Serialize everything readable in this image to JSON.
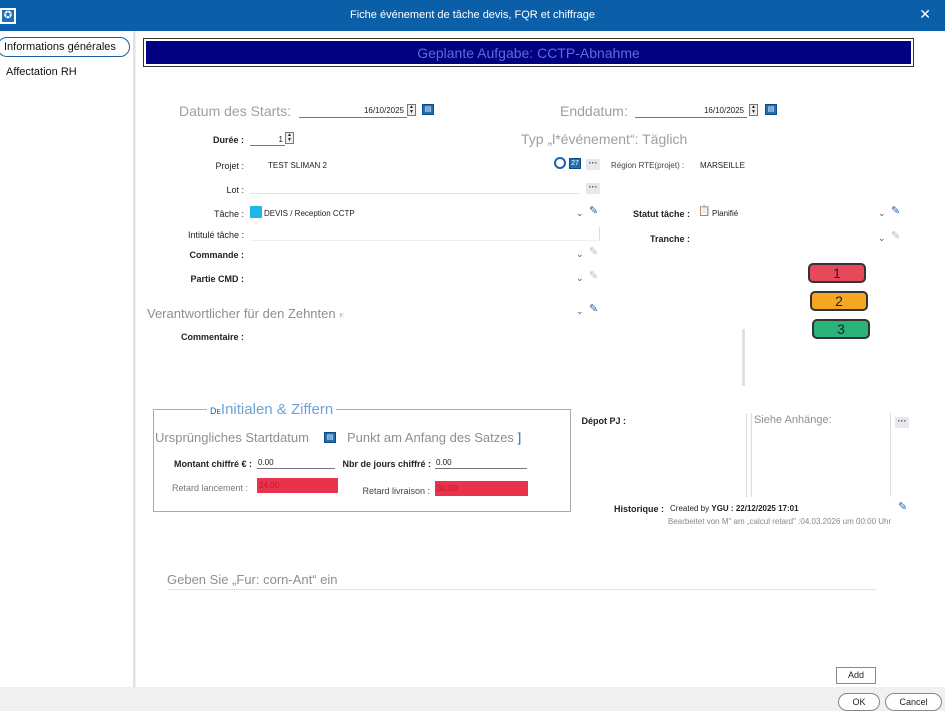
{
  "window": {
    "title": "Fiche événement de tâche devis, FQR et chiffrage",
    "close": "✕",
    "app_icon": "✪"
  },
  "sidebar": {
    "items": [
      {
        "label": "Informations générales"
      },
      {
        "label": "Affectation RH"
      }
    ]
  },
  "header": {
    "title": "Geplante Aufgabe: CCTP-Abnahme"
  },
  "form": {
    "start_label": "Datum des Starts:",
    "start_value": "16/10/2025",
    "end_label": "Enddatum:",
    "end_value": "16/10/2025",
    "duree_label": "Durée :",
    "duree_value": "1",
    "type_label": "Typ „l*événement“: Täglich",
    "projet_label": "Projet :",
    "projet_value": "TEST SLIMAN 2",
    "projet_icon_text": "27",
    "region_label": "Région RTE(projet) :",
    "region_value": "MARSEILLE",
    "lot_label": "Lot :",
    "tache_label": "Tâche :",
    "tache_value": "DEVIS / Reception CCTP",
    "statut_label": "Statut tâche :",
    "statut_value": "Planifié",
    "intitule_label": "Intitulé tâche :",
    "tranche_label": "Tranche :",
    "commande_label": "Commande :",
    "partie_label": "Partie CMD :",
    "zehnten_label": "Verantwortlicher für den Zehnten",
    "zehnten_suffix": "!ᶜ",
    "commentaire_label": "Commentaire :"
  },
  "priorities": [
    {
      "label": "1",
      "color": "#e8495a"
    },
    {
      "label": "2",
      "color": "#f5a623"
    },
    {
      "label": "3",
      "color": "#2bb37a"
    }
  ],
  "group": {
    "legend_prefix": "Dᴇ",
    "legend": "Initialen & Ziffern",
    "orig_start_label": "Ursprüngliches Startdatum",
    "punkt_label": "Punkt am Anfang des Satzes",
    "punkt_suffix": "]",
    "montant_label": "Montant chiffré € :",
    "montant_value": "0.00",
    "jours_label": "Nbr de jours chiffré :",
    "jours_value": "0.00",
    "retard_lancement_label": "Retard lancement :",
    "retard_lancement_value": "24.00",
    "retard_livraison_label": "Retard livraison :",
    "retard_livraison_value": "30.00"
  },
  "attachments": {
    "depot_label": "Dépot PJ :",
    "siehe_label": "Siehe Anhänge:"
  },
  "historique": {
    "label": "Historique :",
    "created_prefix": "Created by",
    "created_value": "YGU : 22/12/2025 17:01",
    "edited": "Bearbeitet von M\" am „calcul retard\" :04.03.2026 um 00:00 Uhr"
  },
  "comment_input": {
    "placeholder": "Geben Sie „Fur: corn-Ant“ ein"
  },
  "buttons": {
    "add": "Add",
    "ok": "OK",
    "cancel": "Cancel"
  },
  "icons": {
    "calendar": "calendar-icon",
    "spinner": "spinner-icon",
    "dots": "more-dots-icon",
    "pen": "pen-icon",
    "chevron": "chevron-down-icon",
    "radio": "radio-icon",
    "status": "status-planned-icon"
  },
  "colors": {
    "titlebar": "#0b5fa8",
    "header": "#000080",
    "retard": "#e8334a"
  }
}
